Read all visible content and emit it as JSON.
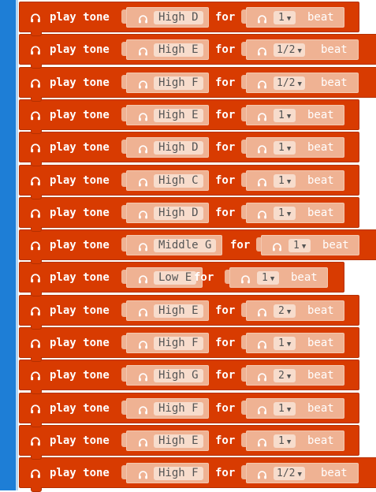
{
  "labels": {
    "play_tone": "play tone",
    "for": "for",
    "beat": "beat"
  },
  "colors": {
    "block": "#d83b01",
    "slot": "#efb293",
    "pill": "#f7dccc",
    "sidebar": "#1e7ed6"
  },
  "blocks": [
    {
      "note": "High D",
      "beats": "1"
    },
    {
      "note": "High E",
      "beats": "1/2"
    },
    {
      "note": "High F",
      "beats": "1/2"
    },
    {
      "note": "High E",
      "beats": "1"
    },
    {
      "note": "High D",
      "beats": "1"
    },
    {
      "note": "High C",
      "beats": "1"
    },
    {
      "note": "High D",
      "beats": "1"
    },
    {
      "note": "Middle G",
      "beats": "1"
    },
    {
      "note": "Low E",
      "beats": "1"
    },
    {
      "note": "High E",
      "beats": "2"
    },
    {
      "note": "High F",
      "beats": "1"
    },
    {
      "note": "High G",
      "beats": "2"
    },
    {
      "note": "High F",
      "beats": "1"
    },
    {
      "note": "High E",
      "beats": "1"
    },
    {
      "note": "High F",
      "beats": "1/2"
    }
  ]
}
